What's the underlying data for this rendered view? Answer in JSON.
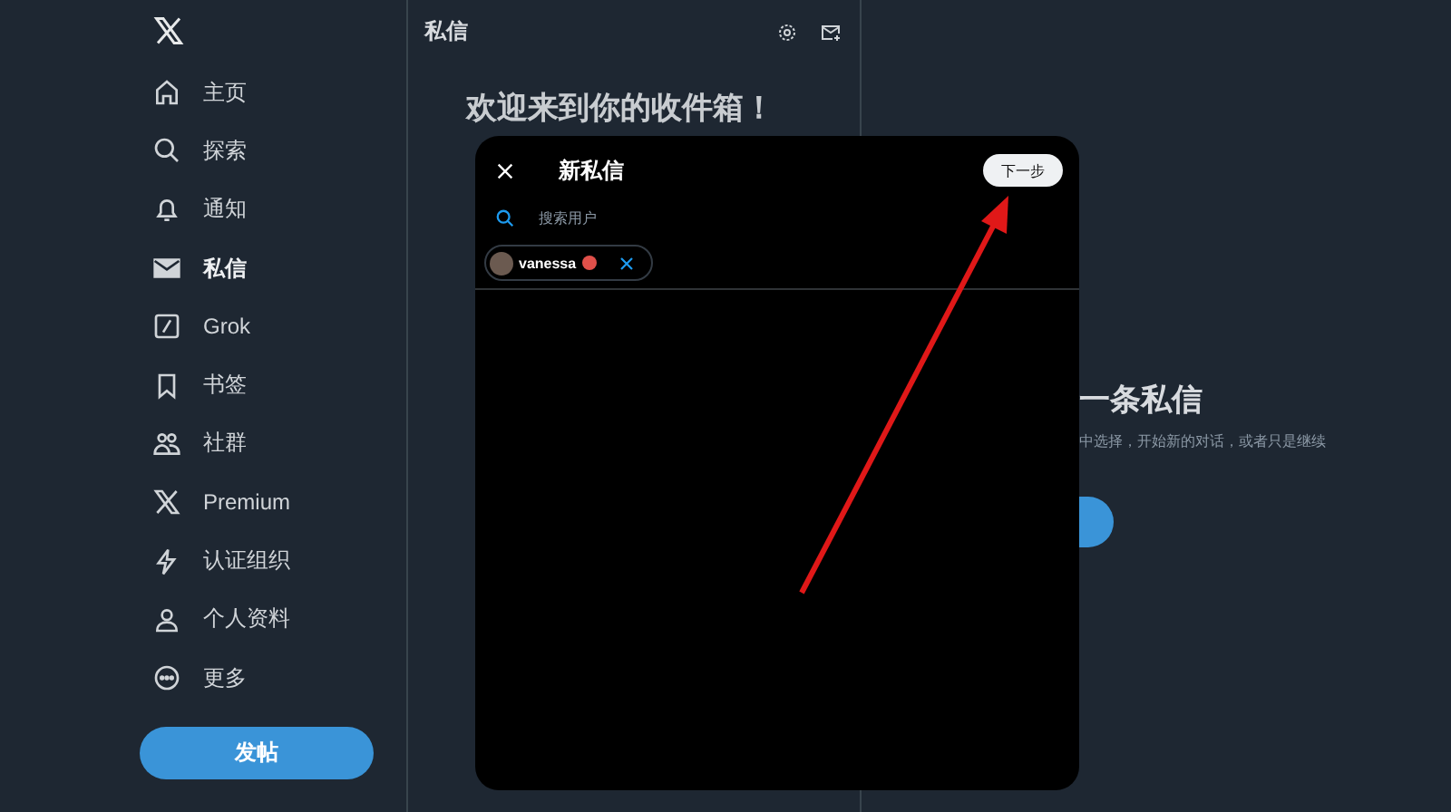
{
  "sidebar": {
    "items": [
      {
        "kind": "home",
        "label": "主页",
        "selected": false
      },
      {
        "kind": "search",
        "label": "探索",
        "selected": false
      },
      {
        "kind": "bell",
        "label": "通知",
        "selected": false
      },
      {
        "kind": "mail",
        "label": "私信",
        "selected": true
      },
      {
        "kind": "grok",
        "label": "Grok",
        "selected": false
      },
      {
        "kind": "bookmark",
        "label": "书签",
        "selected": false
      },
      {
        "kind": "people",
        "label": "社群",
        "selected": false
      },
      {
        "kind": "x",
        "label": "Premium",
        "selected": false
      },
      {
        "kind": "bolt",
        "label": "认证组织",
        "selected": false
      },
      {
        "kind": "person",
        "label": "个人资料",
        "selected": false
      },
      {
        "kind": "more",
        "label": "更多",
        "selected": false
      }
    ],
    "post_button": "发帖"
  },
  "messages": {
    "title": "私信",
    "welcome_heading": "欢迎来到你的收件箱！"
  },
  "detail": {
    "heading": "一条私信",
    "subtitle": "中选择，开始新的对话，或者只是继续"
  },
  "modal": {
    "title": "新私信",
    "next_button": "下一步",
    "search": {
      "placeholder": "搜索用户"
    },
    "chips": [
      {
        "name": "vanessa"
      }
    ]
  }
}
